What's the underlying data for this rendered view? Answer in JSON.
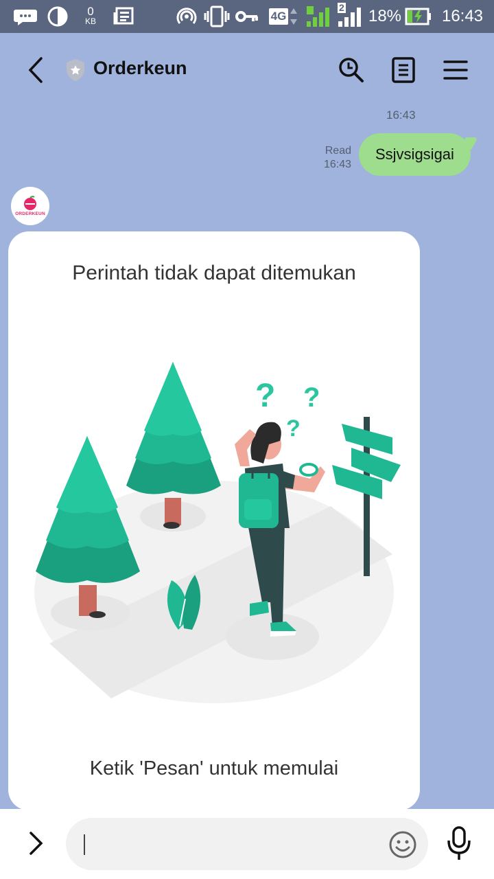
{
  "status_bar": {
    "net_speed_value": "0",
    "net_speed_unit": "KB",
    "network_type": "4G",
    "sim2_label": "2",
    "battery_percent": "18%",
    "time": "16:43"
  },
  "header": {
    "title": "Orderkeun"
  },
  "chat": {
    "date_time": "16:43",
    "my_message": {
      "text": "Ssjvsigsigai",
      "status": "Read",
      "time": "16:43"
    },
    "bot": {
      "avatar_label": "ORDERKEUN",
      "card_title": "Perintah tidak dapat ditemukan",
      "card_footer": "Ketik 'Pesan' untuk memulai"
    }
  },
  "input_bar": {
    "placeholder": ""
  },
  "colors": {
    "chat_background": "#9fb3dc",
    "my_bubble": "#9edc8e",
    "illustration_green": "#1fb892",
    "brand_pink": "#e4276a"
  }
}
